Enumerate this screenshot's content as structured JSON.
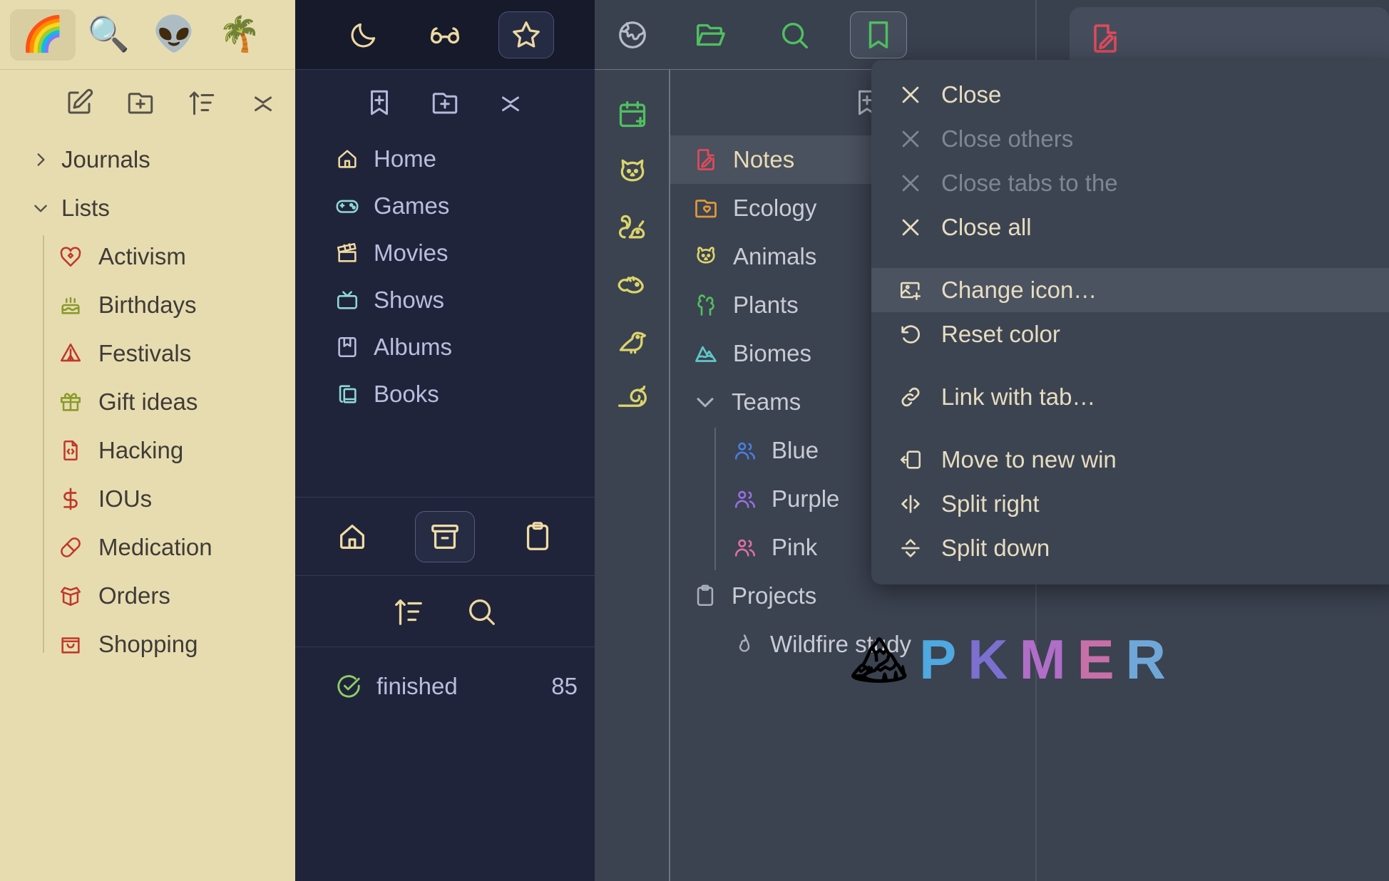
{
  "cream_panel": {
    "emoji_tabs": [
      {
        "name": "rainbow-tab",
        "glyph": "🌈",
        "active": true
      },
      {
        "name": "magnifier-tab",
        "glyph": "🔍",
        "active": false
      },
      {
        "name": "alien-tab",
        "glyph": "👽",
        "active": false
      },
      {
        "name": "palm-tree-tab",
        "glyph": "🌴",
        "active": false
      }
    ],
    "tools": [
      "new-note-icon",
      "new-folder-icon",
      "sort-icon",
      "collapse-icon"
    ],
    "sections": [
      {
        "label": "Journals",
        "expanded": false
      },
      {
        "label": "Lists",
        "expanded": true
      }
    ],
    "list_items": [
      {
        "label": "Activism",
        "icon": "heart-handshake-icon",
        "color": "#c0392b"
      },
      {
        "label": "Birthdays",
        "icon": "cake-icon",
        "color": "#8a9a2b"
      },
      {
        "label": "Festivals",
        "icon": "tent-icon",
        "color": "#c0392b"
      },
      {
        "label": "Gift ideas",
        "icon": "gift-icon",
        "color": "#8a9a2b"
      },
      {
        "label": "Hacking",
        "icon": "file-code-icon",
        "color": "#c0392b"
      },
      {
        "label": "IOUs",
        "icon": "dollar-icon",
        "color": "#c0392b"
      },
      {
        "label": "Medication",
        "icon": "pill-icon",
        "color": "#c0392b"
      },
      {
        "label": "Orders",
        "icon": "package-open-icon",
        "color": "#c0392b"
      },
      {
        "label": "Shopping",
        "icon": "shopping-bag-icon",
        "color": "#c0392b"
      }
    ]
  },
  "navy_panel": {
    "ribbon": [
      {
        "name": "moon-icon",
        "active": false
      },
      {
        "name": "glasses-icon",
        "active": false
      },
      {
        "name": "star-icon",
        "active": true
      }
    ],
    "tools": [
      "new-bookmark-icon",
      "new-folder-icon",
      "collapse-icon"
    ],
    "items": [
      {
        "label": "Home",
        "icon": "house-icon",
        "color": "#efd9a0"
      },
      {
        "label": "Games",
        "icon": "gamepad-icon",
        "color": "#8fd8d8"
      },
      {
        "label": "Movies",
        "icon": "clapperboard-icon",
        "color": "#efd9a0"
      },
      {
        "label": "Shows",
        "icon": "tv-icon",
        "color": "#8fd8d8"
      },
      {
        "label": "Albums",
        "icon": "album-icon",
        "color": "#b9bedd"
      },
      {
        "label": "Books",
        "icon": "books-icon",
        "color": "#8fd8d8"
      }
    ],
    "bottom_buttons": [
      {
        "name": "home-icon",
        "active": false
      },
      {
        "name": "archive-box-icon",
        "active": true
      },
      {
        "name": "clipboard-icon",
        "active": false
      }
    ],
    "search_row": [
      "sort-icon",
      "search-icon"
    ],
    "status": {
      "label": "finished",
      "count": "85",
      "icon": "check-circle-icon",
      "color": "#8fce67"
    }
  },
  "rail": {
    "top_icon": "globe-icon",
    "items": [
      {
        "name": "calendar-plus-icon",
        "color": "#4fbf5f"
      },
      {
        "name": "cat-icon",
        "color": "#dbd46a"
      },
      {
        "name": "squirrel-icon",
        "color": "#dbd46a"
      },
      {
        "name": "fish-icon",
        "color": "#dbd46a"
      },
      {
        "name": "bird-icon",
        "color": "#dbd46a"
      },
      {
        "name": "snail-icon",
        "color": "#dbd46a"
      }
    ]
  },
  "notes_panel": {
    "ribbon": [
      {
        "name": "open-folder-icon",
        "color": "#4fbf5f",
        "active": false
      },
      {
        "name": "search-icon",
        "color": "#4fbf5f",
        "active": false
      },
      {
        "name": "bookmark-icon",
        "color": "#4fbf5f",
        "active": true
      }
    ],
    "tools": [
      "new-bookmark-icon",
      "new-folder-icon"
    ],
    "items": [
      {
        "label": "Notes",
        "icon": "file-pen-icon",
        "color": "#e04a5a",
        "selected": true,
        "depth": 0
      },
      {
        "label": "Ecology",
        "icon": "folder-heart-icon",
        "color": "#e09a3a",
        "selected": false,
        "depth": 0
      },
      {
        "label": "Animals",
        "icon": "dog-icon",
        "color": "#dbd46a",
        "selected": false,
        "depth": 0
      },
      {
        "label": "Plants",
        "icon": "trees-icon",
        "color": "#4fbf5f",
        "selected": false,
        "depth": 0
      },
      {
        "label": "Biomes",
        "icon": "mountain-icon",
        "color": "#5fc8c8",
        "selected": false,
        "depth": 0
      },
      {
        "label": "Teams",
        "icon": "chevron-down-icon",
        "color": "#aab0bb",
        "selected": false,
        "depth": 0,
        "group": true
      },
      {
        "label": "Blue",
        "icon": "users-icon",
        "color": "#4a7ee0",
        "selected": false,
        "depth": 1
      },
      {
        "label": "Purple",
        "icon": "users-icon",
        "color": "#9b6fe0",
        "selected": false,
        "depth": 1
      },
      {
        "label": "Pink",
        "icon": "users-icon",
        "color": "#e06fa8",
        "selected": false,
        "depth": 1
      },
      {
        "label": "Projects",
        "icon": "clipboard-icon",
        "color": "#aab0bb",
        "selected": false,
        "depth": 0
      },
      {
        "label": "Wildfire study",
        "icon": "flame-icon",
        "color": "#aab0bb",
        "selected": false,
        "depth": 1
      }
    ]
  },
  "context_menu": {
    "items": [
      {
        "label": "Close",
        "icon": "x-icon",
        "disabled": false,
        "highlighted": false
      },
      {
        "label": "Close others",
        "icon": "x-icon",
        "disabled": true,
        "highlighted": false
      },
      {
        "label": "Close tabs to the",
        "icon": "x-icon",
        "disabled": true,
        "highlighted": false
      },
      {
        "label": "Close all",
        "icon": "x-icon",
        "disabled": false,
        "highlighted": false
      },
      {
        "label": "Change icon…",
        "icon": "image-plus-icon",
        "disabled": false,
        "highlighted": true
      },
      {
        "label": "Reset color",
        "icon": "undo-icon",
        "disabled": false,
        "highlighted": false
      },
      {
        "label": "Link with tab…",
        "icon": "link-icon",
        "disabled": false,
        "highlighted": false
      },
      {
        "label": "Move to new win",
        "icon": "move-window-icon",
        "disabled": false,
        "highlighted": false
      },
      {
        "label": "Split right",
        "icon": "split-horizontal-icon",
        "disabled": false,
        "highlighted": false
      },
      {
        "label": "Split down",
        "icon": "split-vertical-icon",
        "disabled": false,
        "highlighted": false
      }
    ]
  },
  "watermark": {
    "logo": "🏔",
    "letters": [
      "P",
      "K",
      "M",
      "E",
      "R"
    ]
  }
}
